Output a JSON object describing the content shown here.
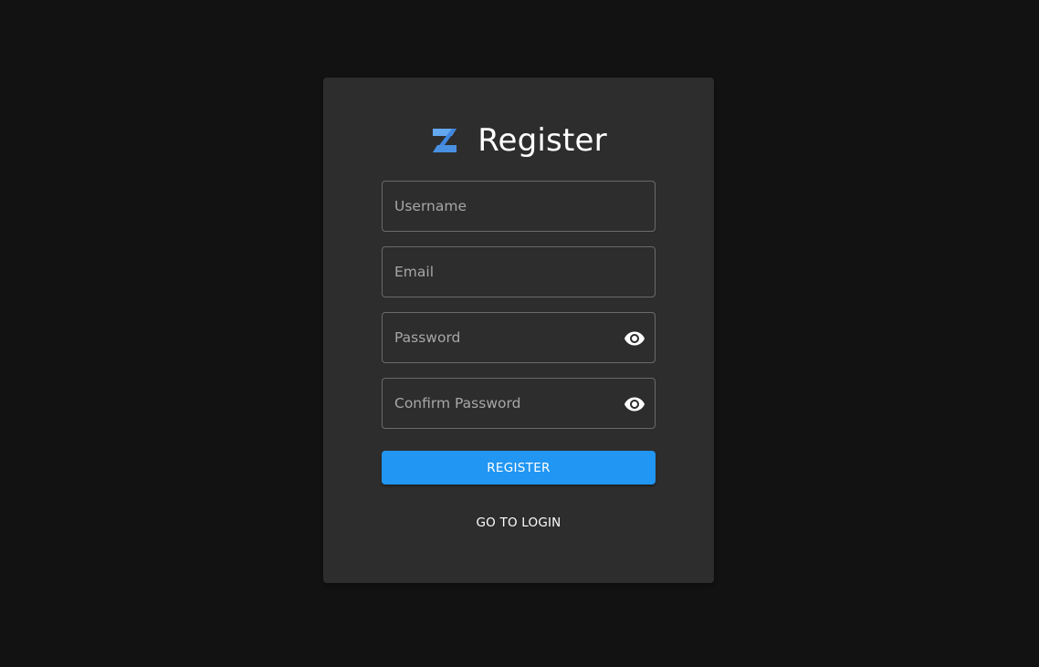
{
  "page": {
    "title": "Register",
    "logo_icon": "z-logo-icon",
    "accent_color": "#2196f3",
    "logo_color": "#4a90e2"
  },
  "form": {
    "username": {
      "placeholder": "Username",
      "value": ""
    },
    "email": {
      "placeholder": "Email",
      "value": ""
    },
    "password": {
      "placeholder": "Password",
      "value": "",
      "icon": "eye-icon"
    },
    "confirm_password": {
      "placeholder": "Confirm Password",
      "value": "",
      "icon": "eye-icon"
    },
    "register_label": "REGISTER",
    "go_to_login_label": "GO TO LOGIN"
  }
}
